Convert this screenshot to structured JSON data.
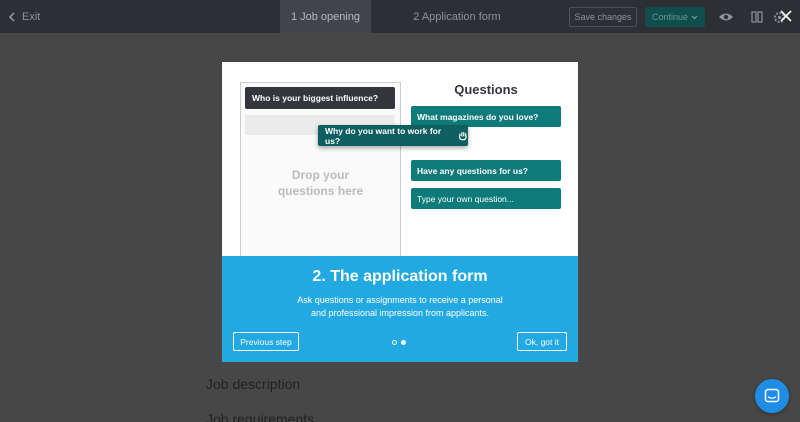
{
  "topbar": {
    "exit_label": "Exit",
    "steps": [
      {
        "label": "1 Job opening",
        "active": true
      },
      {
        "label": "2 Application form",
        "active": false
      }
    ],
    "save_label": "Save changes",
    "continue_label": "Continue"
  },
  "background": {
    "headings": [
      "Job description",
      "Job requirements"
    ]
  },
  "modal": {
    "preview": {
      "pinned_question": "Who is your biggest influence?",
      "drop_text": "Drop your questions here",
      "dragging_question": "Why do you want to work for us?",
      "questions_title": "Questions",
      "questions": [
        "What magazines do you love?",
        "Have any questions for us?"
      ],
      "custom_question_placeholder": "Type your own question..."
    },
    "title": "2. The application form",
    "description_line1": "Ask questions or assignments to receive a personal",
    "description_line2": "and professional impression from applicants.",
    "prev_label": "Previous step",
    "ok_label": "Ok, got it",
    "steps_total": 2,
    "step_current": 2
  },
  "colors": {
    "topbar": "#2c2f33",
    "overlay": "#474747",
    "teal": "#0f7a7a",
    "blue_panel": "#23a9e2",
    "chat": "#1f8ce6"
  }
}
